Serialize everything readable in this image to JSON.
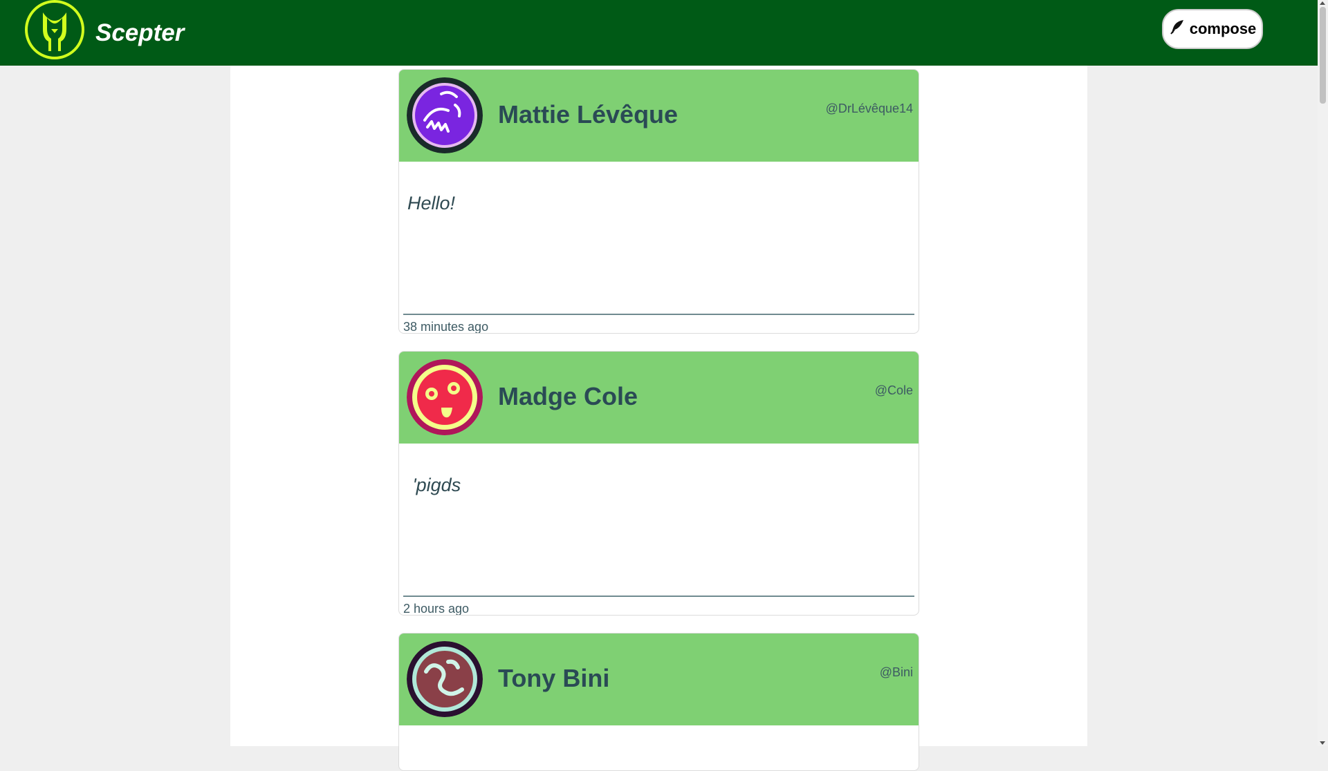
{
  "header": {
    "brand": "Scepter",
    "compose_label": "compose",
    "colors": {
      "bar": "#005a16",
      "logo": "#d2ff1e"
    }
  },
  "posts": [
    {
      "name": "Mattie Lévêque",
      "handle": "@DrLévêque14",
      "text": "Hello!",
      "time": "38 minutes ago",
      "avatar_icon": "squiggle-face-icon",
      "avatar_colors": {
        "ring": "#1a2a2a",
        "fill": "#6b1fd6",
        "inner": "#8a3ae8",
        "accent": "#ffffff"
      }
    },
    {
      "name": "Madge Cole",
      "handle": "@Cole",
      "text": " 'pigds",
      "time": "2 hours ago",
      "avatar_icon": "smiley-face-icon",
      "avatar_colors": {
        "ring": "#b0165a",
        "fill": "#f4ff8a",
        "inner": "#f02a4a",
        "accent": "#ffffff"
      }
    },
    {
      "name": "Tony Bini",
      "handle": "@Bini",
      "text": "",
      "time": "",
      "avatar_icon": "worm-face-icon",
      "avatar_colors": {
        "ring": "#2a1030",
        "fill": "#b0e8d8",
        "inner": "#8a4048",
        "accent": "#d0f4e8"
      }
    }
  ]
}
